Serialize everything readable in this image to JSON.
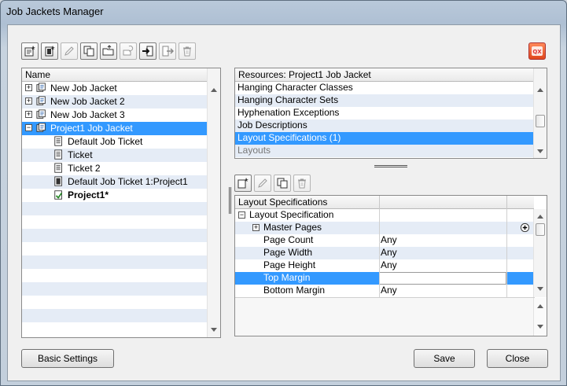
{
  "window": {
    "title": "Job Jackets Manager"
  },
  "toolbar": {
    "buttons": [
      {
        "icon": "new-jacket-icon"
      },
      {
        "icon": "new-ticket-icon"
      },
      {
        "icon": "edit-pencil-icon"
      },
      {
        "icon": "duplicate-icon"
      },
      {
        "icon": "open-folder-icon"
      },
      {
        "icon": "link-icon"
      },
      {
        "icon": "import-icon"
      },
      {
        "icon": "export-icon"
      },
      {
        "icon": "trash-icon"
      }
    ],
    "qx_icon": "quarkxpress-icon"
  },
  "tree": {
    "header": "Name",
    "items": [
      {
        "label": "New Job Jacket",
        "indent": 0,
        "expander": "+",
        "icon": "job-jacket-icon"
      },
      {
        "label": "New Job Jacket 2",
        "indent": 0,
        "expander": "+",
        "icon": "job-jacket-icon"
      },
      {
        "label": "New Job Jacket 3",
        "indent": 0,
        "expander": "+",
        "icon": "job-jacket-icon"
      },
      {
        "label": "Project1 Job Jacket",
        "indent": 0,
        "expander": "−",
        "icon": "job-jacket-icon",
        "selected": true
      },
      {
        "label": "Default Job Ticket",
        "indent": 1,
        "icon": "ticket-icon"
      },
      {
        "label": "Ticket",
        "indent": 1,
        "icon": "ticket-icon"
      },
      {
        "label": "Ticket 2",
        "indent": 1,
        "icon": "ticket-icon"
      },
      {
        "label": "Default Job Ticket 1:Project1",
        "indent": 1,
        "icon": "ticket-linked-icon"
      },
      {
        "label": "Project1*",
        "indent": 1,
        "icon": "project-icon",
        "bold": true
      }
    ]
  },
  "resources": {
    "header": "Resources: Project1 Job Jacket",
    "items": [
      {
        "label": "Hanging Character Classes"
      },
      {
        "label": "Hanging Character Sets"
      },
      {
        "label": "Hyphenation Exceptions"
      },
      {
        "label": "Job Descriptions"
      },
      {
        "label": "Layout Specifications (1)",
        "selected": true
      },
      {
        "label": "Layouts",
        "faded": true
      }
    ]
  },
  "spec_toolbar": {
    "buttons": [
      {
        "icon": "new-spec-icon"
      },
      {
        "icon": "edit-pencil-icon"
      },
      {
        "icon": "duplicate-icon"
      },
      {
        "icon": "trash-icon"
      }
    ]
  },
  "specs": {
    "header": "Layout Specifications",
    "rows": [
      {
        "label": "Layout Specification",
        "value": "",
        "level": 0,
        "expander": "−"
      },
      {
        "label": "Master Pages",
        "value": "",
        "level": 1,
        "expander": "+",
        "action": "add-circle-icon"
      },
      {
        "label": "Page Count",
        "value": "Any",
        "level": 2
      },
      {
        "label": "Page Width",
        "value": "Any",
        "level": 2
      },
      {
        "label": "Page Height",
        "value": "Any",
        "level": 2
      },
      {
        "label": "Top Margin",
        "value": "",
        "level": 2,
        "selected": true
      },
      {
        "label": "Bottom Margin",
        "value": "Any",
        "level": 2
      }
    ]
  },
  "buttons": {
    "basic_settings": "Basic Settings",
    "save": "Save",
    "close": "Close"
  }
}
